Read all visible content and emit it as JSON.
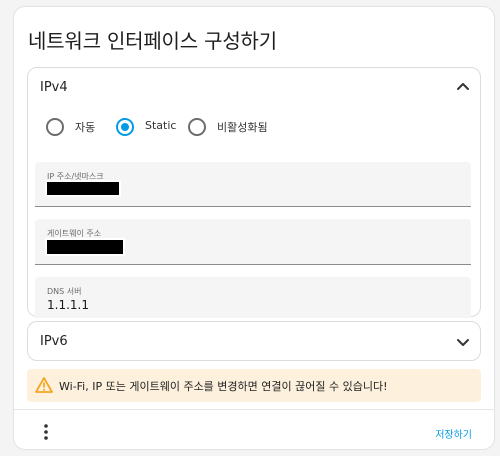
{
  "dialog": {
    "title": "네트워크 인터페이스 구성하기"
  },
  "ipv4": {
    "title": "IPv4",
    "expanded": true,
    "modes": [
      {
        "label": "자동",
        "checked": false
      },
      {
        "label": "Static",
        "checked": true
      },
      {
        "label": "비활성화됨",
        "checked": false
      }
    ],
    "fields": {
      "ip": {
        "label": "IP 주소/넷마스크",
        "value": ""
      },
      "gateway": {
        "label": "게이트웨이 주소",
        "value": ""
      },
      "dns": {
        "label": "DNS 서버",
        "value": "1.1.1.1"
      }
    }
  },
  "ipv6": {
    "title": "IPv6",
    "expanded": false
  },
  "warning": {
    "text": "Wi-Fi, IP 또는 게이트웨이 주소를 변경하면 연결이 끊어질 수 있습니다!",
    "icon": "warning-icon"
  },
  "footer": {
    "menu_icon": "more-vertical-icon",
    "save_label": "저장하기"
  },
  "colors": {
    "accent": "#039be5",
    "warning_bg": "#fdf0dd",
    "warning_icon": "#f5a623"
  }
}
